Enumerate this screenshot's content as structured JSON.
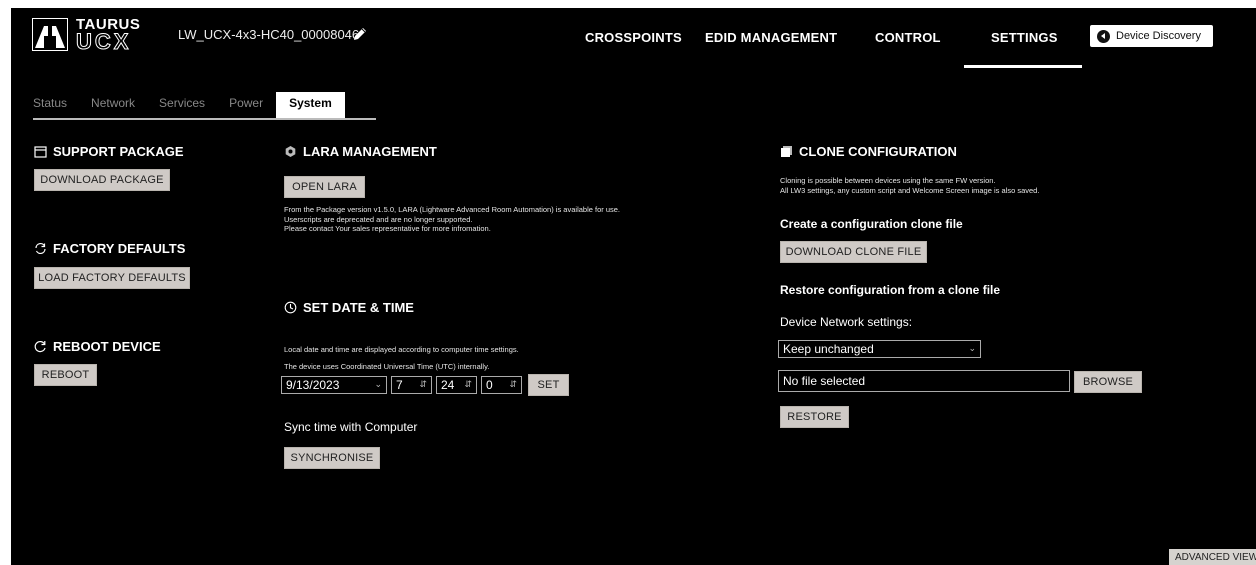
{
  "brand": {
    "line1": "TAURUS",
    "line2": "UCX"
  },
  "device_name": "LW_UCX-4x3-HC40_00008046",
  "nav": {
    "crosspoints": "CROSSPOINTS",
    "edid": "EDID MANAGEMENT",
    "control": "CONTROL",
    "settings": "SETTINGS",
    "active": "SETTINGS"
  },
  "device_discovery": "Device Discovery",
  "tabs": {
    "status": "Status",
    "network": "Network",
    "services": "Services",
    "power": "Power",
    "system": "System",
    "active": "System"
  },
  "support": {
    "title": "SUPPORT PACKAGE",
    "button": "DOWNLOAD PACKAGE"
  },
  "factory": {
    "title": "FACTORY DEFAULTS",
    "button": "LOAD FACTORY DEFAULTS"
  },
  "reboot": {
    "title": "REBOOT DEVICE",
    "button": "REBOOT"
  },
  "lara": {
    "title": "LARA MANAGEMENT",
    "button": "OPEN LARA",
    "text1": "From the Package version v1.5.0, LARA (Lightware Advanced Room Automation) is available for use.",
    "text2": "Userscripts are deprecated and are no longer supported.",
    "text3": "Please contact Your sales representative for more infromation."
  },
  "datetime": {
    "title": "SET DATE & TIME",
    "text1": "Local date and time are displayed according to computer time settings.",
    "text2": "The device uses Coordinated Universal Time (UTC) internally.",
    "date": "9/13/2023",
    "hour": "7",
    "minute": "24",
    "second": "0",
    "set_button": "SET",
    "sync_label": "Sync time with Computer",
    "sync_button": "SYNCHRONISE"
  },
  "clone": {
    "title": "CLONE CONFIGURATION",
    "text1": "Cloning is possible between devices using the same FW version.",
    "text2": "All LW3 settings, any custom script and Welcome Screen image is also saved.",
    "create_heading": "Create a configuration clone file",
    "download_button": "DOWNLOAD CLONE FILE",
    "restore_heading": "Restore configuration from a clone file",
    "network_label": "Device Network settings:",
    "network_value": "Keep unchanged",
    "file_value": "No file selected",
    "browse_button": "BROWSE",
    "restore_button": "RESTORE"
  },
  "advanced_view": "ADVANCED VIEW",
  "colors": {
    "background": "#000000",
    "button": "#cfcac6",
    "accent": "#ffffff"
  },
  "icons": [
    "logo-icon",
    "edit-pencil-icon",
    "back-arrow-icon",
    "package-box-icon",
    "refresh-icon",
    "reboot-icon",
    "lara-gear-icon",
    "clock-icon",
    "clone-copy-icon"
  ]
}
